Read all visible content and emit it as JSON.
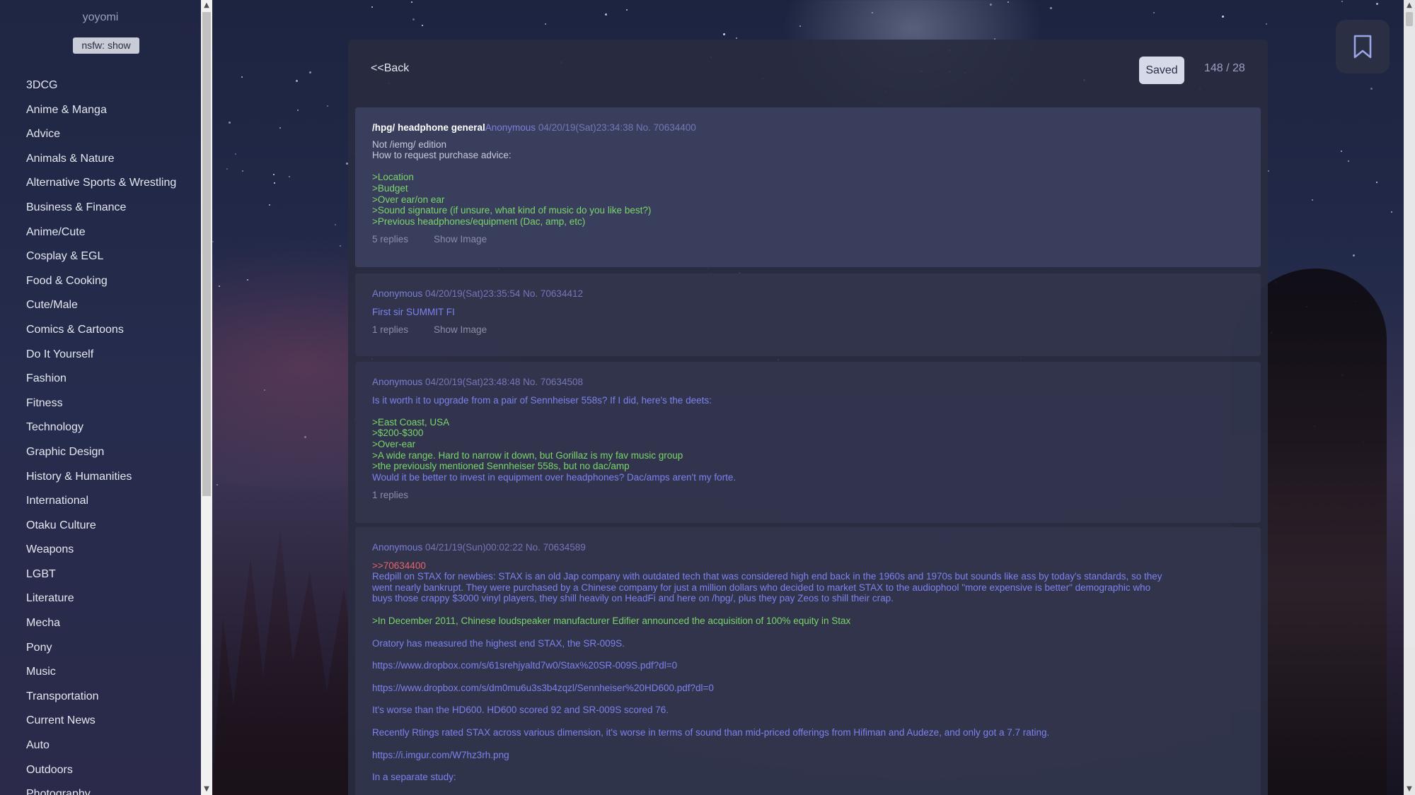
{
  "sidebar": {
    "username": "yoyomi",
    "nsfw_toggle": "nsfw: show",
    "categories": [
      "3DCG",
      "Anime & Manga",
      "Advice",
      "Animals & Nature",
      "Alternative Sports & Wrestling",
      "Business & Finance",
      "Anime/Cute",
      "Cosplay & EGL",
      "Food & Cooking",
      "Cute/Male",
      "Comics & Cartoons",
      "Do It Yourself",
      "Fashion",
      "Fitness",
      "Technology",
      "Graphic Design",
      "History & Humanities",
      "International",
      "Otaku Culture",
      "Weapons",
      "LGBT",
      "Literature",
      "Mecha",
      "Pony",
      "Music",
      "Transportation",
      "Current News",
      "Auto",
      "Outdoors",
      "Photography"
    ]
  },
  "header": {
    "back": "<<Back",
    "saved": "Saved",
    "counter": "148 / 28"
  },
  "posts": [
    {
      "subject": "/hpg/ headphone general",
      "author": "Anonymous",
      "meta": "04/20/19(Sat)23:34:38 No. 70634400",
      "lines": [
        {
          "t": "Not /iemg/ edition",
          "c": ""
        },
        {
          "t": "How to request purchase advice:",
          "c": ""
        },
        {
          "t": "",
          "c": ""
        },
        {
          "t": ">Location",
          "c": "green"
        },
        {
          "t": ">Budget",
          "c": "green"
        },
        {
          "t": ">Over ear/on ear",
          "c": "green"
        },
        {
          "t": ">Sound signature (if unsure, what kind of music do you like best?)",
          "c": "green"
        },
        {
          "t": ">Previous headphones/equipment (Dac, amp, etc)",
          "c": "green"
        }
      ],
      "replies": "5 replies",
      "show_image": "Show Image"
    },
    {
      "author": "Anonymous",
      "meta": "04/20/19(Sat)23:35:54 No. 70634412",
      "lines": [
        {
          "t": "First sir SUMMIT FI",
          "c": "blue"
        }
      ],
      "replies": "1 replies",
      "show_image": "Show Image"
    },
    {
      "author": "Anonymous",
      "meta": "04/20/19(Sat)23:48:48 No. 70634508",
      "lines": [
        {
          "t": "Is it worth it to upgrade from a pair of Sennheiser 558s? If I did, here's the deets:",
          "c": "blue"
        },
        {
          "t": "",
          "c": ""
        },
        {
          "t": ">East Coast, USA",
          "c": "green"
        },
        {
          "t": ">$200-$300",
          "c": "green"
        },
        {
          "t": ">Over-ear",
          "c": "green"
        },
        {
          "t": ">A wide range. Hard to narrow it down, but Gorillaz is my fav music group",
          "c": "green"
        },
        {
          "t": ">the previously mentioned Sennheiser 558s, but no dac/amp",
          "c": "green"
        },
        {
          "t": "Would it be better to invest in equipment over headphones? Dac/amps aren't my forte.",
          "c": "blue"
        }
      ],
      "replies": "1 replies"
    },
    {
      "author": "Anonymous",
      "meta": "04/21/19(Sun)00:02:22 No. 70634589",
      "lines": [
        {
          "t": ">>70634400",
          "c": "red"
        },
        {
          "t": "Redpill on STAX for newbies: STAX is an old Jap company with outdated tech that was considered high end back in the 1960s and 1970s but sounds like ass by today's standards, so they",
          "c": "blue"
        },
        {
          "t": "went nearly bankrupt. They were purchased by a Chinese company for just a million dollars who decided to market STAX to the audiophool \"more expensive is better\" demographic who",
          "c": "blue"
        },
        {
          "t": "buys those crappy $3000 vinyl players, they shill heavily on HeadFi and here on /hpg/, plus they pay Zeos to shill their crap.",
          "c": "blue",
          "p": true
        },
        {
          "t": ">In December 2011, Chinese loudspeaker manufacturer Edifier announced the acquisition of 100% equity in Stax",
          "c": "green",
          "p": true
        },
        {
          "t": "Oratory has measured the highest end STAX, the SR-009S.",
          "c": "blue",
          "p": true
        },
        {
          "t": "https://www.dropbox.com/s/61srehjyaltd7w0/Stax%20SR-009S.pdf?dl=0",
          "c": "blue",
          "p": true
        },
        {
          "t": "https://www.dropbox.com/s/dm0mu6u3s3b4zqzl/Sennheiser%20HD600.pdf?dl=0",
          "c": "blue",
          "p": true
        },
        {
          "t": "It's worse than the HD600. HD600 scored 92 and SR-009S scored 76.",
          "c": "blue",
          "p": true
        },
        {
          "t": "Recently Rtings rated STAX across various dimension, it's worse in terms of sound than mid-priced offerings from Hifiman and Audeze, and only got a 7.7 rating.",
          "c": "blue",
          "p": true
        },
        {
          "t": "https://i.imgur.com/W7hz3rh.png",
          "c": "blue",
          "p": true
        },
        {
          "t": "In a separate study:",
          "c": "blue"
        }
      ]
    }
  ],
  "colors": {
    "greentext": "#7ad66a",
    "body_text": "#7c82ee",
    "quote_link": "#e8626a",
    "author": "#7c7ed6"
  },
  "icons": {
    "bookmark": "bookmark-icon"
  }
}
